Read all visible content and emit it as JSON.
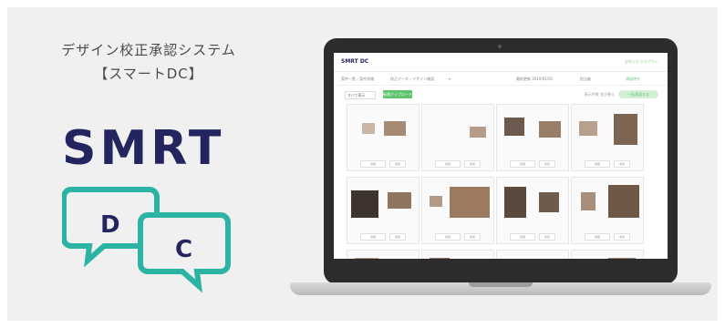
{
  "tagline": {
    "line1": "デザイン校正承認システム",
    "line2": "【スマートDC】"
  },
  "logo": {
    "word": "SMRT",
    "bubble_left": "D",
    "bubble_right": "C",
    "colors": {
      "navy": "#23255e",
      "teal": "#2bb3a3"
    }
  },
  "app": {
    "logo": "SMRT DC",
    "header_right": "お知らせ  ログアウト",
    "breadcrumb": [
      "案件一覧  ›  案件詳細",
      "校正データ  ›  デザイン確認",
      "▾"
    ],
    "breadcrumb_right": [
      "最終更新 2019/01/01",
      "担当者",
      "承認待ち"
    ],
    "toolbar": {
      "select_label": "すべて表示",
      "primary_button": "新規アップロード",
      "right_text": "表示件数  並び替え",
      "right_button": "一括承認する"
    },
    "card_controls": [
      "詳細",
      "承認"
    ]
  },
  "colors": {
    "background": "#f0f0f0",
    "accent_green": "#5cc46b",
    "laptop_frame": "#2c2c2e"
  }
}
